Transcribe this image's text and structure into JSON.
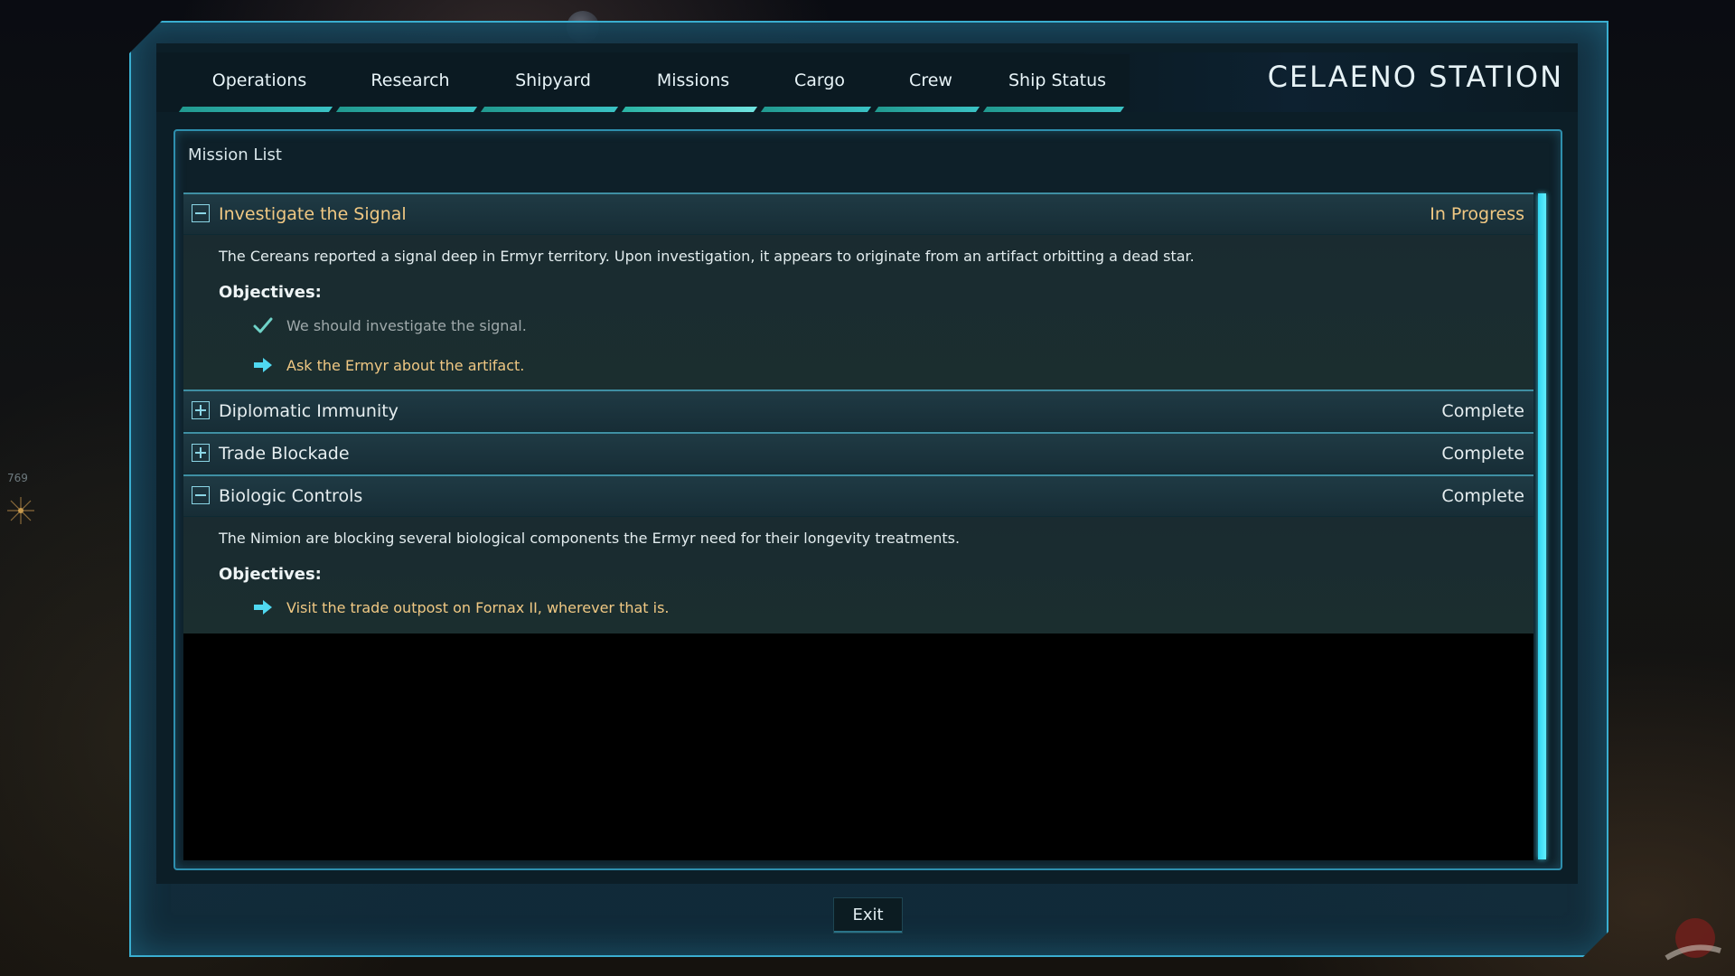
{
  "station": {
    "title": "CELAENO STATION"
  },
  "nav": {
    "tabs": [
      {
        "label": "Operations"
      },
      {
        "label": "Research"
      },
      {
        "label": "Shipyard"
      },
      {
        "label": "Missions",
        "active": true
      },
      {
        "label": "Cargo"
      },
      {
        "label": "Crew"
      },
      {
        "label": "Ship Status"
      }
    ]
  },
  "panel": {
    "title": "Mission List"
  },
  "missions": [
    {
      "name": "Investigate the Signal",
      "status": "In Progress",
      "expanded": true,
      "description": "The Cereans reported a signal deep in Ermyr territory. Upon investigation, it appears to originate from an artifact orbitting a dead star.",
      "objectives_label": "Objectives:",
      "objectives": [
        {
          "text": "We should investigate the signal.",
          "state": "done",
          "icon": "checkmark-icon"
        },
        {
          "text": "Ask the Ermyr about the artifact.",
          "state": "current",
          "icon": "arrow-right-icon"
        }
      ]
    },
    {
      "name": "Diplomatic Immunity",
      "status": "Complete",
      "expanded": false
    },
    {
      "name": "Trade Blockade",
      "status": "Complete",
      "expanded": false
    },
    {
      "name": "Biologic Controls",
      "status": "Complete",
      "expanded": true,
      "description": "The Nimion are blocking several biological components the Ermyr need for their longevity treatments.",
      "objectives_label": "Objectives:",
      "objectives": [
        {
          "text": "Visit the trade outpost on Fornax II, wherever that is.",
          "state": "current",
          "icon": "arrow-right-icon"
        }
      ]
    }
  ],
  "exit_button": {
    "label": "Exit"
  },
  "hud": {
    "coordinate": "769"
  },
  "colors": {
    "accent": "#3ac2c4",
    "highlight_text": "#f0c883",
    "frame_border": "#3aaed0",
    "scrollbar": "#5ff0ff"
  }
}
